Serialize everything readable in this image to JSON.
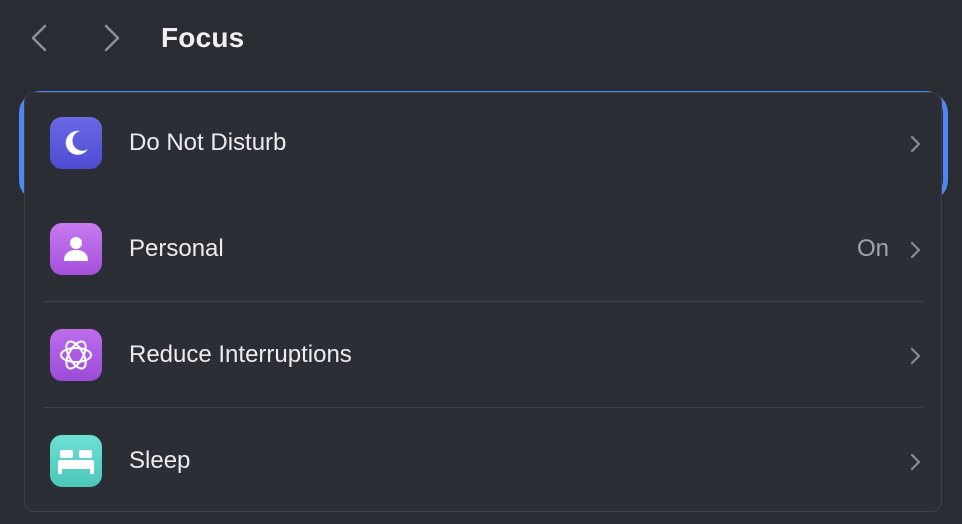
{
  "header": {
    "title": "Focus",
    "back_icon": "chevron-left-icon",
    "forward_icon": "chevron-right-icon"
  },
  "focus_modes": [
    {
      "label": "Do Not Disturb",
      "status": "",
      "icon": "moon-icon",
      "color": "#5b5ade",
      "selected": true
    },
    {
      "label": "Personal",
      "status": "On",
      "icon": "person-icon",
      "color": "#b462e6"
    },
    {
      "label": "Reduce Interruptions",
      "status": "",
      "icon": "apple-intelligence-icon",
      "color": "#ad5ce3"
    },
    {
      "label": "Sleep",
      "status": "",
      "icon": "bed-icon",
      "color": "#5dd4c8"
    }
  ],
  "colors": {
    "background": "#2a2c33",
    "selection_ring": "#4f86f0",
    "secondary_text": "#a2a4aa"
  }
}
